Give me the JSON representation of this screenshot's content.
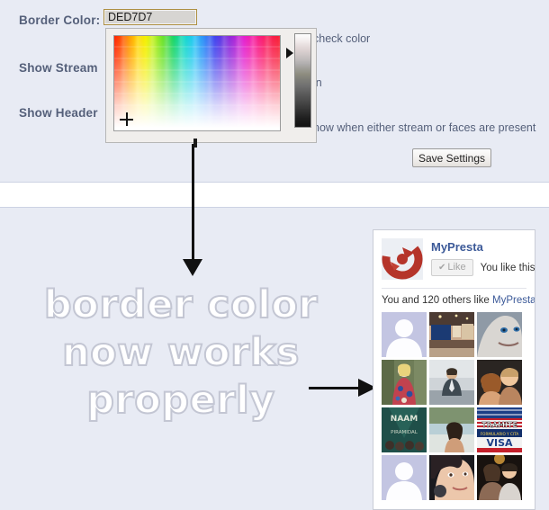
{
  "settings": {
    "border_color_label": "Border Color:",
    "border_color_value": "DED7D7",
    "show_stream_label": "Show Stream",
    "show_header_label": "Show Header",
    "hint_check_color": "check color",
    "hint_in": "in",
    "hint_show_when": "now when either stream or faces are present",
    "save_label": "Save Settings"
  },
  "picker": {
    "selected_hex": "DED7D7"
  },
  "annotation": {
    "line1": "border color",
    "line2": "now works",
    "line3": "properly"
  },
  "fb_widget": {
    "page_name": "MyPresta",
    "like_button_label": "Like",
    "like_check_glyph": "✔",
    "you_like_this": "You like this.",
    "friends_prefix": "You and 120 others like ",
    "friends_link": "MyPresta",
    "friends_suffix": ".",
    "faces": [
      {
        "name": "silhouette-avatar",
        "type": "silhouette"
      },
      {
        "name": "bedroom-photo",
        "type": "bedroom"
      },
      {
        "name": "portrait-blue-eyes",
        "type": "face-pale"
      },
      {
        "name": "woman-floral-dress",
        "type": "woman-outdoor"
      },
      {
        "name": "man-seated-suit",
        "type": "man-suit"
      },
      {
        "name": "couple-portrait",
        "type": "couple"
      },
      {
        "name": "naam-piramidal-poster",
        "type": "poster-naam"
      },
      {
        "name": "woman-by-pool",
        "type": "woman-pool"
      },
      {
        "name": "tramite-visa-banner",
        "type": "poster-visa"
      },
      {
        "name": "silhouette-avatar-2",
        "type": "silhouette"
      },
      {
        "name": "woman-closeup",
        "type": "woman-closeup"
      },
      {
        "name": "couple-night-photo",
        "type": "couple-night"
      }
    ]
  },
  "colors": {
    "page_bg": "#e8ebf4",
    "label_text": "#55607a",
    "fb_blue": "#3b5998",
    "outline_gray": "#c3c6d3",
    "picker_bg": "#f0eeec"
  }
}
